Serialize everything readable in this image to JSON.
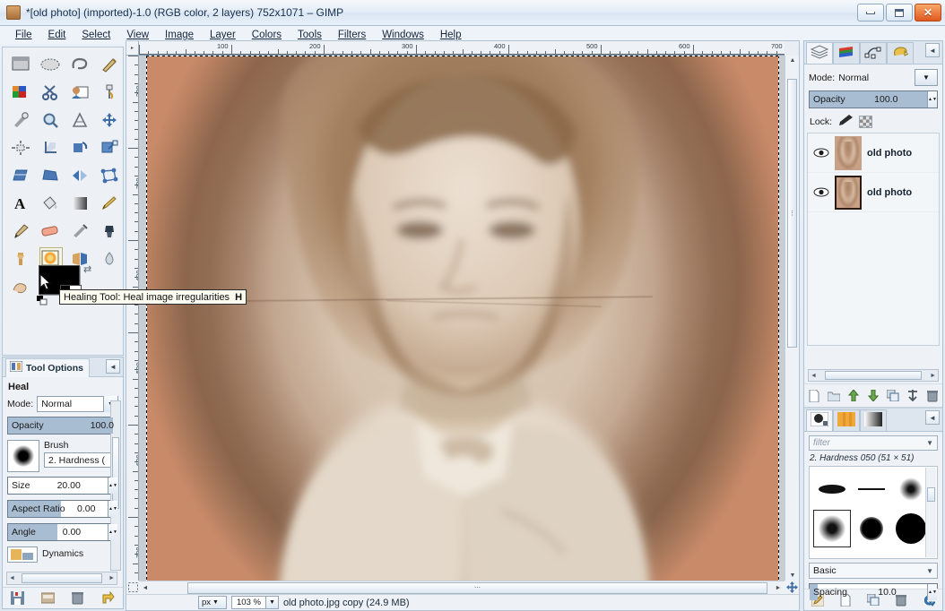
{
  "window": {
    "title": "*[old photo] (imported)-1.0 (RGB color, 2 layers) 752x1071 – GIMP",
    "icon": "gimp-wilber-icon",
    "minimize": "Minimize",
    "maximize": "Maximize",
    "close": "Close"
  },
  "menubar": {
    "items": [
      {
        "label": "File"
      },
      {
        "label": "Edit"
      },
      {
        "label": "Select"
      },
      {
        "label": "View"
      },
      {
        "label": "Image"
      },
      {
        "label": "Layer"
      },
      {
        "label": "Colors"
      },
      {
        "label": "Tools"
      },
      {
        "label": "Filters"
      },
      {
        "label": "Windows"
      },
      {
        "label": "Help"
      }
    ]
  },
  "toolbox": {
    "tools": [
      {
        "name": "rect-select-tool",
        "title": "Rectangle Select"
      },
      {
        "name": "ellipse-select-tool",
        "title": "Ellipse Select"
      },
      {
        "name": "free-select-tool",
        "title": "Free Select"
      },
      {
        "name": "fuzzy-select-tool",
        "title": "Fuzzy Select"
      },
      {
        "name": "select-by-color-tool",
        "title": "Select by Color"
      },
      {
        "name": "scissors-select-tool",
        "title": "Scissors Select"
      },
      {
        "name": "foreground-select-tool",
        "title": "Foreground Select"
      },
      {
        "name": "paths-tool",
        "title": "Paths"
      },
      {
        "name": "color-picker-tool",
        "title": "Color Picker"
      },
      {
        "name": "zoom-tool",
        "title": "Zoom"
      },
      {
        "name": "measure-tool",
        "title": "Measure"
      },
      {
        "name": "move-tool",
        "title": "Move"
      },
      {
        "name": "alignment-tool",
        "title": "Alignment"
      },
      {
        "name": "crop-tool",
        "title": "Crop"
      },
      {
        "name": "rotate-tool",
        "title": "Rotate"
      },
      {
        "name": "scale-tool",
        "title": "Scale"
      },
      {
        "name": "shear-tool",
        "title": "Shear"
      },
      {
        "name": "perspective-tool",
        "title": "Perspective"
      },
      {
        "name": "flip-tool",
        "title": "Flip"
      },
      {
        "name": "cage-transform-tool",
        "title": "Cage Transform"
      },
      {
        "name": "text-tool",
        "title": "Text"
      },
      {
        "name": "bucket-fill-tool",
        "title": "Bucket Fill"
      },
      {
        "name": "gradient-tool",
        "title": "Blend"
      },
      {
        "name": "pencil-tool",
        "title": "Pencil"
      },
      {
        "name": "paintbrush-tool",
        "title": "Paintbrush"
      },
      {
        "name": "eraser-tool",
        "title": "Eraser"
      },
      {
        "name": "airbrush-tool",
        "title": "Airbrush"
      },
      {
        "name": "ink-tool",
        "title": "Ink"
      },
      {
        "name": "clone-tool",
        "title": "Clone"
      },
      {
        "name": "healing-tool",
        "title": "Healing Tool",
        "active": true
      },
      {
        "name": "perspective-clone-tool",
        "title": "Perspective Clone"
      },
      {
        "name": "blur-sharpen-tool",
        "title": "Blur / Sharpen"
      },
      {
        "name": "smudge-tool",
        "title": "Smudge"
      }
    ],
    "foreground_color": "#000000",
    "background_color": "#ffffff",
    "swap_icon": "swap-colors-icon",
    "reset_icon": "reset-colors-icon"
  },
  "tooltip": {
    "text": "Healing Tool: Heal image irregularities",
    "shortcut": "H"
  },
  "tool_options": {
    "tab_label": "Tool Options",
    "tab_icon": "tool-options-icon",
    "menu_icon": "dock-menu-icon",
    "title": "Heal",
    "mode_label": "Mode:",
    "mode_value": "Normal",
    "opacity_label": "Opacity",
    "opacity_value": "100.0",
    "brush_label": "Brush",
    "brush_value": "2. Hardness (",
    "size_label": "Size",
    "size_value": "20.00",
    "aspect_label": "Aspect Ratio",
    "aspect_value": "0.00",
    "angle_label": "Angle",
    "angle_value": "0.00",
    "dynamics_label": "Dynamics",
    "buttons": [
      {
        "name": "save-tool-preset-button",
        "icon": "save-icon"
      },
      {
        "name": "restore-tool-preset-button",
        "icon": "restore-icon"
      },
      {
        "name": "delete-tool-preset-button",
        "icon": "trash-icon"
      },
      {
        "name": "reset-tool-options-button",
        "icon": "reset-icon"
      }
    ]
  },
  "canvas": {
    "ruler_h_labels": [
      "100",
      "200",
      "300",
      "400",
      "500",
      "600",
      "700"
    ],
    "ruler_v_labels": [
      "200",
      "300",
      "400",
      "500",
      "600",
      "700"
    ],
    "quickmask_icon": "quick-mask-icon",
    "navigation_icon": "navigation-move-icon",
    "image_description": "sepia vignette portrait of a bearded man with a crack across the image"
  },
  "statusbar": {
    "unit": "px",
    "zoom": "103 %",
    "text": "old photo.jpg copy (24.9 MB)"
  },
  "layers_dock": {
    "tabs": [
      {
        "name": "tab-layers",
        "icon": "layers-icon",
        "selected": true
      },
      {
        "name": "tab-channels",
        "icon": "channels-icon",
        "selected": false
      },
      {
        "name": "tab-paths",
        "icon": "paths-icon",
        "selected": false
      },
      {
        "name": "tab-undo-history",
        "icon": "undo-history-icon",
        "selected": false
      }
    ],
    "menu_icon": "dock-menu-icon",
    "mode_label": "Mode:",
    "mode_value": "Normal",
    "opacity_label": "Opacity",
    "opacity_value": "100.0",
    "lock_label": "Lock:",
    "lock_pixels_icon": "lock-pixels-brush-icon",
    "lock_alpha_icon": "lock-alpha-checker-icon",
    "layers": [
      {
        "name": "old photo",
        "visible": true,
        "selected": false
      },
      {
        "name": "old photo",
        "visible": true,
        "selected": true
      }
    ],
    "buttons": [
      {
        "name": "new-layer-button",
        "icon": "new-page-icon"
      },
      {
        "name": "new-layer-group-button",
        "icon": "folder-icon"
      },
      {
        "name": "raise-layer-button",
        "icon": "arrow-up-icon"
      },
      {
        "name": "lower-layer-button",
        "icon": "arrow-down-icon"
      },
      {
        "name": "duplicate-layer-button",
        "icon": "duplicate-icon"
      },
      {
        "name": "anchor-layer-button",
        "icon": "anchor-icon"
      },
      {
        "name": "delete-layer-button",
        "icon": "trash-icon"
      }
    ]
  },
  "brushes_dock": {
    "tabs": [
      {
        "name": "tab-brushes",
        "icon": "brush-dot-icon",
        "selected": true
      },
      {
        "name": "tab-patterns",
        "icon": "pattern-icon",
        "selected": false
      },
      {
        "name": "tab-gradients",
        "icon": "gradient-icon",
        "selected": false
      }
    ],
    "menu_icon": "dock-menu-icon",
    "filter_placeholder": "filter",
    "selected_brush": "2. Hardness 050 (51 × 51)",
    "tag_value": "Basic",
    "spacing_label": "Spacing",
    "spacing_value": "10.0",
    "buttons": [
      {
        "name": "edit-brush-button",
        "icon": "pencil-edit-icon"
      },
      {
        "name": "new-brush-button",
        "icon": "new-page-icon"
      },
      {
        "name": "duplicate-brush-button",
        "icon": "duplicate-icon"
      },
      {
        "name": "delete-brush-button",
        "icon": "trash-icon"
      },
      {
        "name": "refresh-brushes-button",
        "icon": "refresh-icon"
      }
    ]
  }
}
